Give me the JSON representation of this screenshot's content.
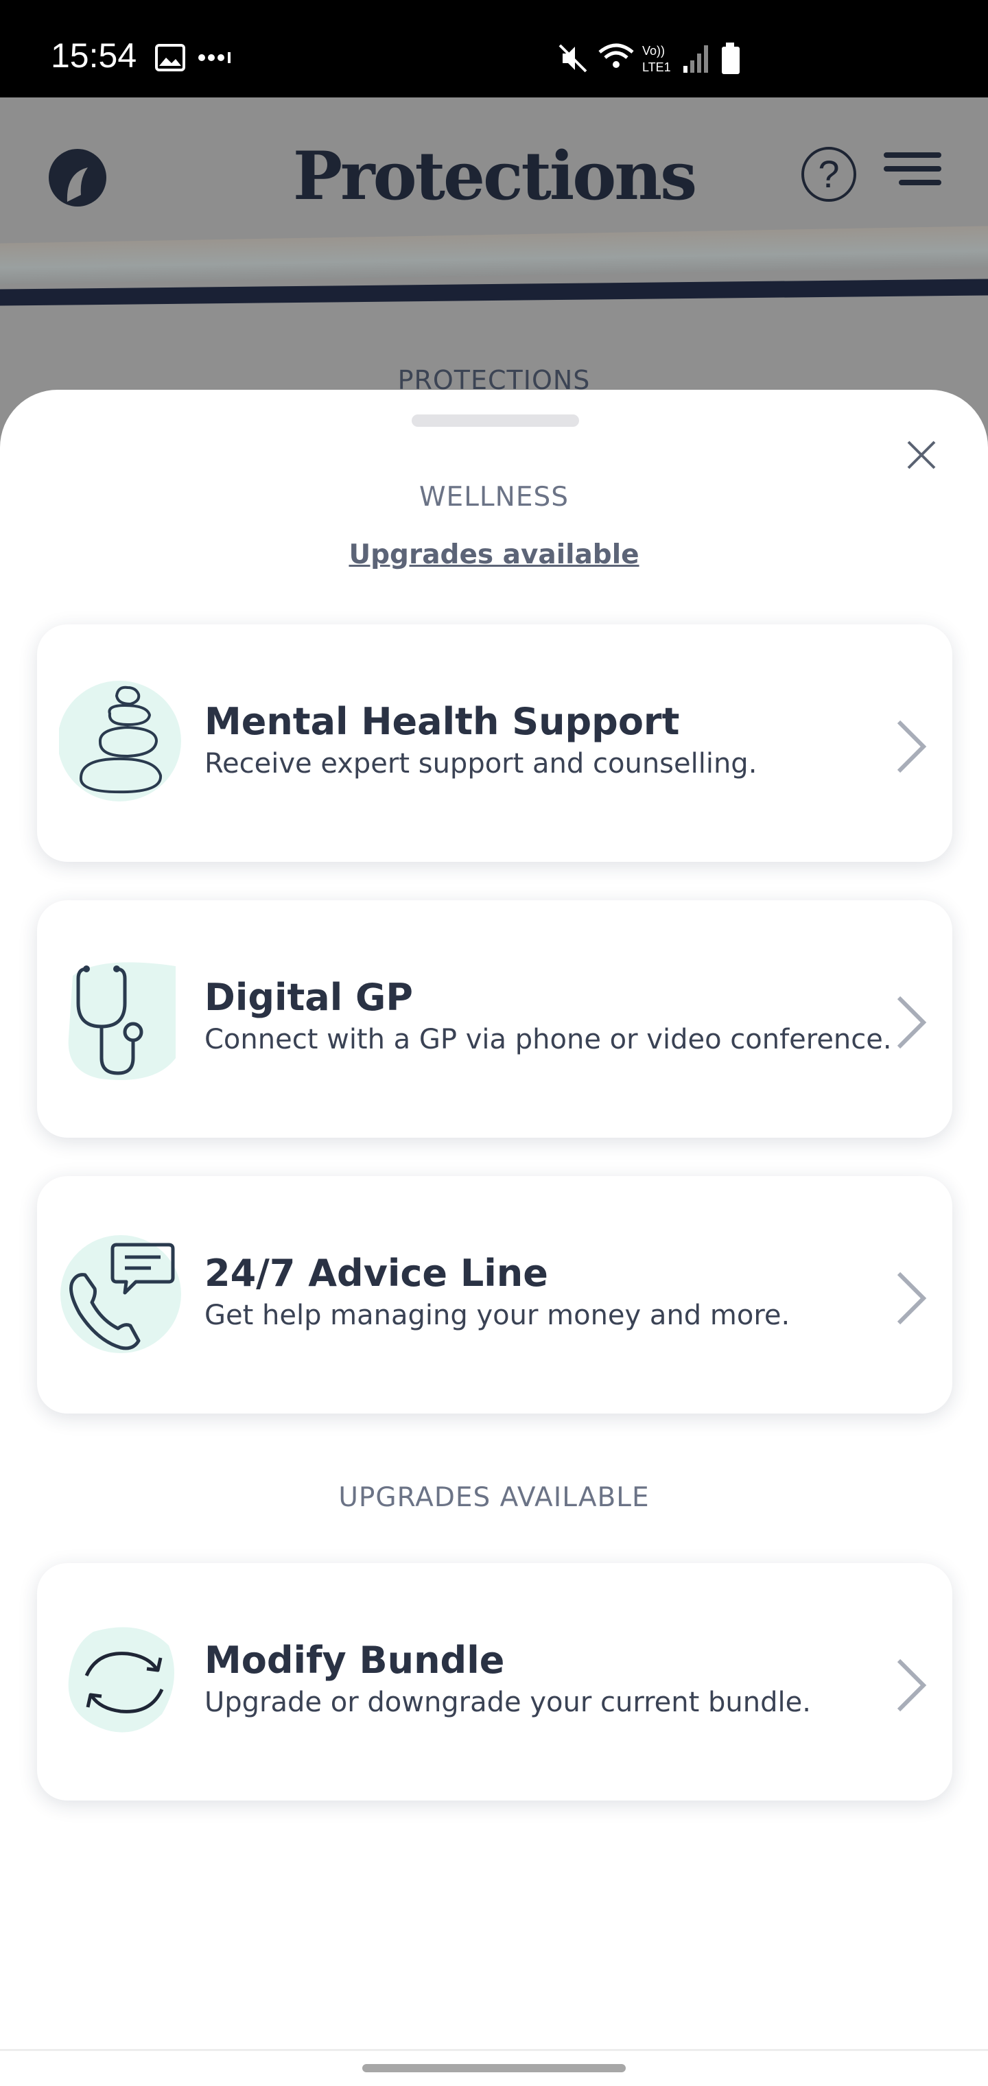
{
  "status_bar": {
    "time": "15:54"
  },
  "app": {
    "title": "Protections",
    "help_label": "?",
    "behind_section_label": "PROTECTIONS"
  },
  "sheet": {
    "section_title": "WELLNESS",
    "upgrades_link": "Upgrades available",
    "cards": [
      {
        "title": "Mental Health Support",
        "desc": "Receive expert support and counselling.",
        "icon": "stacked-stones-icon"
      },
      {
        "title": "Digital GP",
        "desc": "Connect with a GP via phone or video conference.",
        "icon": "stethoscope-icon"
      },
      {
        "title": "24/7 Advice Line",
        "desc": "Get help managing your money and more.",
        "icon": "phone-chat-icon"
      }
    ],
    "upgrades_section_title": "UPGRADES AVAILABLE",
    "upgrade_card": {
      "title": "Modify Bundle",
      "desc": "Upgrade or downgrade your current bundle.",
      "icon": "refresh-icon"
    }
  },
  "colors": {
    "accent_mint": "#e3f6f1",
    "icon_stroke": "#2a3a4e",
    "title_text": "#2a3244"
  }
}
